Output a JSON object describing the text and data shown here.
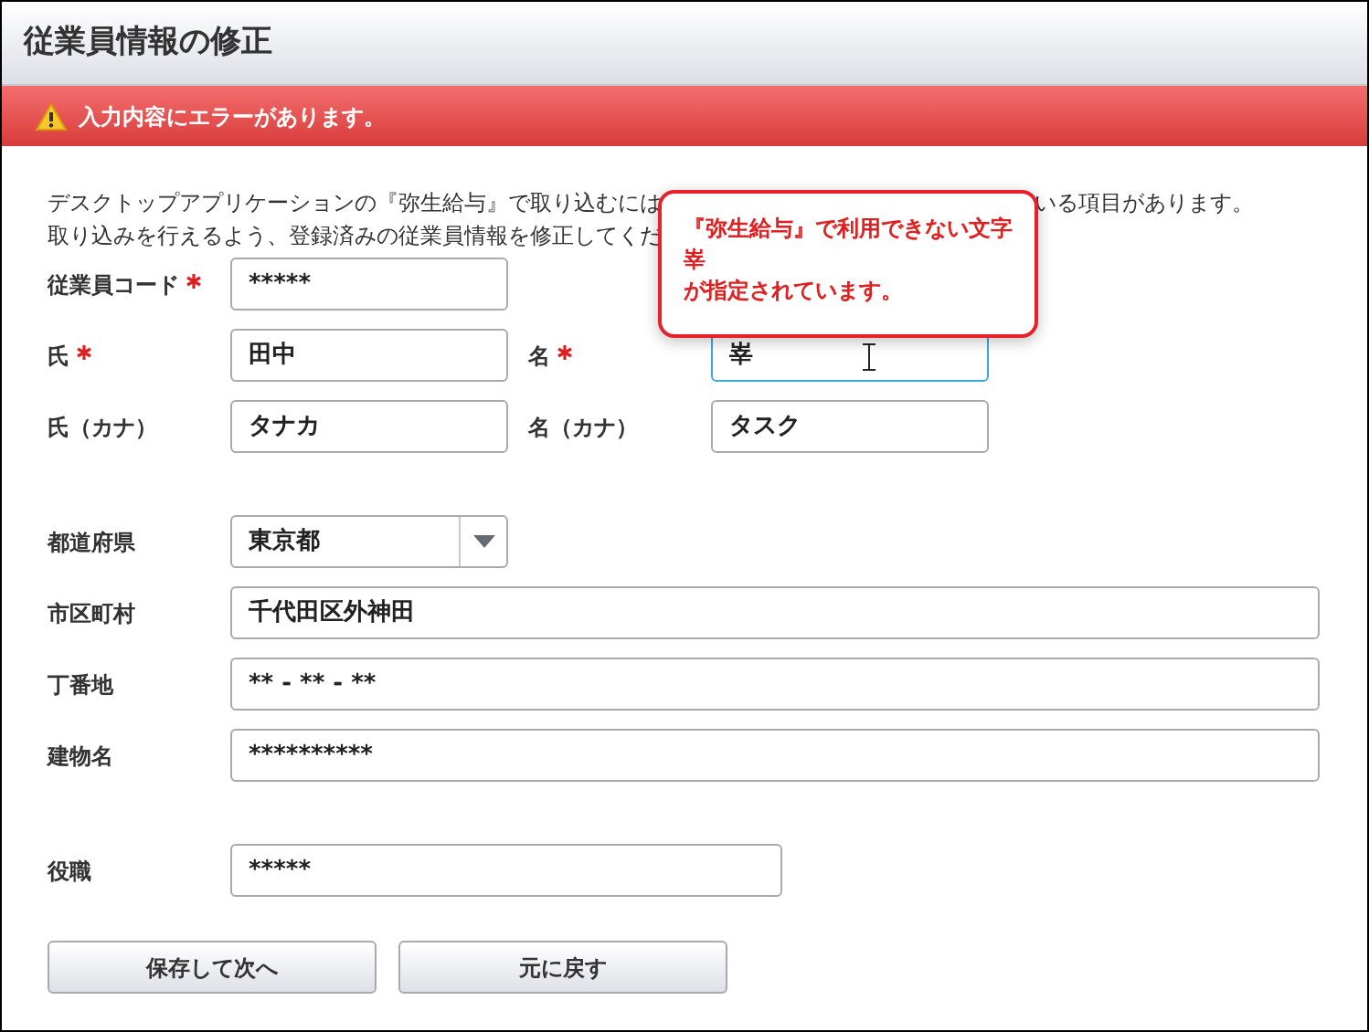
{
  "window": {
    "title": "従業員情報の修正"
  },
  "error_bar": {
    "message": "入力内容にエラーがあります。"
  },
  "intro": {
    "line_1_start": "デスクトップアプリケーションの『弥生給与』で取り込むには",
    "line_1_end": "いる項目があります。",
    "line_2": "取り込みを行えるよう、登録済みの従業員情報を修正してくだ"
  },
  "tooltip": {
    "lines": [
      "『弥生給与』で利用できない文字",
      "峷",
      "が指定されています。"
    ]
  },
  "sections": [
    {
      "rows": [
        {
          "fields": [
            {
              "label": "従業員コード",
              "required": true,
              "kind": "short_text",
              "value": "*****",
              "focused": false
            }
          ]
        },
        {
          "fields": [
            {
              "label": "氏",
              "required": true,
              "kind": "short_text",
              "value": "田中",
              "focused": false
            },
            {
              "label": "名",
              "required": true,
              "kind": "short_text",
              "value": "峷",
              "focused": true
            }
          ]
        },
        {
          "fields": [
            {
              "label": "氏（カナ）",
              "required": false,
              "kind": "short_text",
              "value": "タナカ",
              "focused": false
            },
            {
              "label": "名（カナ）",
              "required": false,
              "kind": "short_text",
              "value": "タスク",
              "focused": false
            }
          ]
        }
      ]
    },
    {
      "rows": [
        {
          "fields": [
            {
              "label": "都道府県",
              "required": false,
              "kind": "select",
              "value": "東京都",
              "focused": false
            }
          ]
        },
        {
          "fields": [
            {
              "label": "市区町村",
              "required": false,
              "kind": "long_text",
              "value": "千代田区外神田",
              "focused": false
            }
          ]
        },
        {
          "fields": [
            {
              "label": "丁番地",
              "required": false,
              "kind": "long_text",
              "value": "** - ** - **",
              "focused": false
            }
          ]
        },
        {
          "fields": [
            {
              "label": "建物名",
              "required": false,
              "kind": "long_text",
              "value": "**********",
              "focused": false
            }
          ]
        }
      ]
    },
    {
      "rows": [
        {
          "fields": [
            {
              "label": "役職",
              "required": false,
              "kind": "medium_text",
              "value": "*****",
              "focused": false
            }
          ]
        }
      ]
    }
  ],
  "buttons": [
    "保存して次へ",
    "元に戻す"
  ]
}
